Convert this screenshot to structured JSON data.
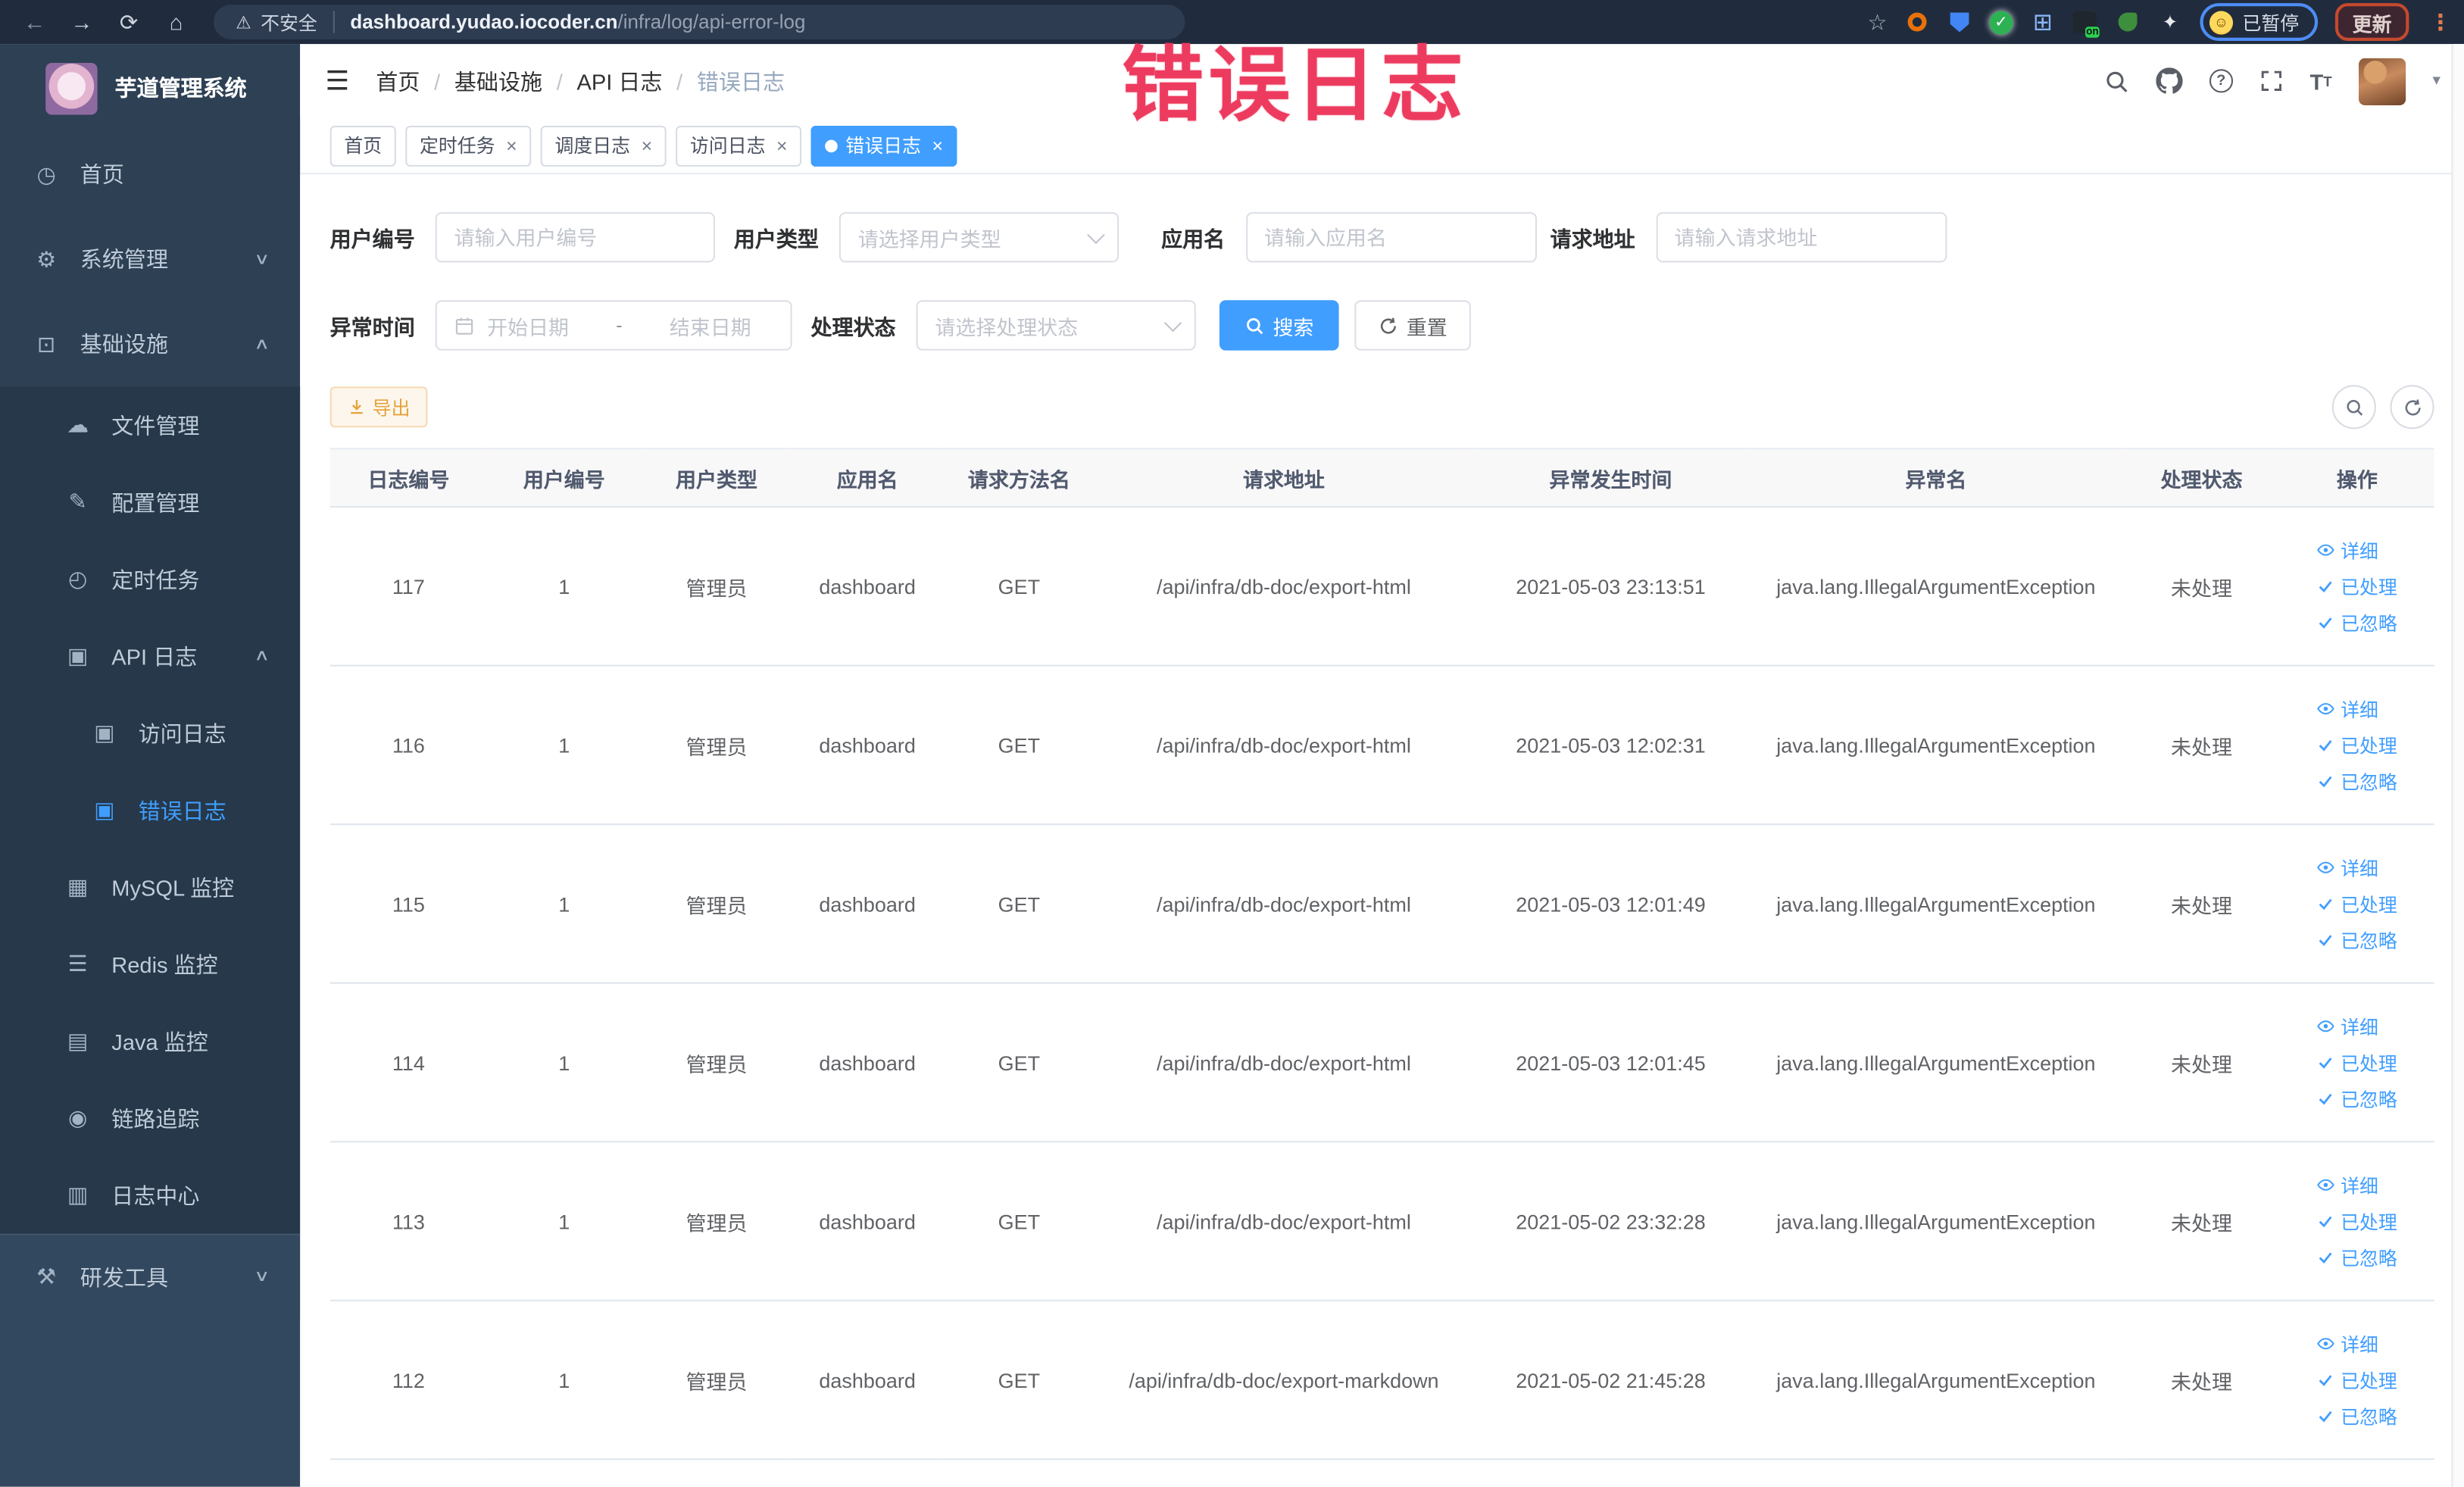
{
  "browser": {
    "security_label": "不安全",
    "url_host": "dashboard.yudao.iocoder.cn",
    "url_path": "/infra/log/api-error-log",
    "extension_badge": "on",
    "paused_badge": "已暂停",
    "update_label": "更新"
  },
  "annotation": "错误日志",
  "sidebar": {
    "title": "芋道管理系统",
    "items": [
      {
        "label": "首页",
        "icon": "dashboard-icon",
        "level": 1
      },
      {
        "label": "系统管理",
        "icon": "gear-icon",
        "level": 1,
        "arrow": "down"
      },
      {
        "label": "基础设施",
        "icon": "infrastructure-icon",
        "level": 1,
        "arrow": "up"
      },
      {
        "label": "文件管理",
        "icon": "file-manage-icon",
        "level": 2
      },
      {
        "label": "配置管理",
        "icon": "config-manage-icon",
        "level": 2
      },
      {
        "label": "定时任务",
        "icon": "scheduled-task-icon",
        "level": 2
      },
      {
        "label": "API 日志",
        "icon": "api-log-icon",
        "level": 2,
        "arrow": "up"
      },
      {
        "label": "访问日志",
        "icon": "access-log-icon",
        "level": 3
      },
      {
        "label": "错误日志",
        "icon": "error-log-icon",
        "level": 3,
        "active": true
      },
      {
        "label": "MySQL 监控",
        "icon": "mysql-monitor-icon",
        "level": 2
      },
      {
        "label": "Redis 监控",
        "icon": "redis-monitor-icon",
        "level": 2
      },
      {
        "label": "Java 监控",
        "icon": "java-monitor-icon",
        "level": 2
      },
      {
        "label": "链路追踪",
        "icon": "trace-icon",
        "level": 2
      },
      {
        "label": "日志中心",
        "icon": "log-center-icon",
        "level": 2
      },
      {
        "label": "研发工具",
        "icon": "devtools-icon",
        "level": 1,
        "arrow": "down",
        "section": "lower"
      }
    ]
  },
  "header": {
    "breadcrumbs": [
      "首页",
      "基础设施",
      "API 日志",
      "错误日志"
    ],
    "icons": [
      "search-icon",
      "github-icon",
      "help-icon",
      "fullscreen-icon",
      "font-size-icon",
      "avatar",
      "caret-down-icon"
    ]
  },
  "tabs": [
    {
      "label": "首页",
      "closable": false,
      "active": false
    },
    {
      "label": "定时任务",
      "closable": true,
      "active": false
    },
    {
      "label": "调度日志",
      "closable": true,
      "active": false
    },
    {
      "label": "访问日志",
      "closable": true,
      "active": false
    },
    {
      "label": "错误日志",
      "closable": true,
      "active": true
    }
  ],
  "filters": {
    "user_id": {
      "label": "用户编号",
      "placeholder": "请输入用户编号"
    },
    "user_type": {
      "label": "用户类型",
      "placeholder": "请选择用户类型"
    },
    "app_name": {
      "label": "应用名",
      "placeholder": "请输入应用名"
    },
    "request_url": {
      "label": "请求地址",
      "placeholder": "请输入请求地址"
    },
    "exception_time": {
      "label": "异常时间",
      "start_placeholder": "开始日期",
      "separator": "-",
      "end_placeholder": "结束日期"
    },
    "process_status": {
      "label": "处理状态",
      "placeholder": "请选择处理状态"
    },
    "search_label": "搜索",
    "reset_label": "重置"
  },
  "toolbar": {
    "export_label": "导出"
  },
  "table": {
    "columns": [
      "日志编号",
      "用户编号",
      "用户类型",
      "应用名",
      "请求方法名",
      "请求地址",
      "异常发生时间",
      "异常名",
      "处理状态",
      "操作"
    ],
    "actions": [
      "详细",
      "已处理",
      "已忽略"
    ],
    "rows": [
      {
        "id": "117",
        "user_id": "1",
        "user_type": "管理员",
        "app": "dashboard",
        "method": "GET",
        "url": "/api/infra/db-doc/export-html",
        "time": "2021-05-03 23:13:51",
        "exception": "java.lang.IllegalArgumentException",
        "status": "未处理"
      },
      {
        "id": "116",
        "user_id": "1",
        "user_type": "管理员",
        "app": "dashboard",
        "method": "GET",
        "url": "/api/infra/db-doc/export-html",
        "time": "2021-05-03 12:02:31",
        "exception": "java.lang.IllegalArgumentException",
        "status": "未处理"
      },
      {
        "id": "115",
        "user_id": "1",
        "user_type": "管理员",
        "app": "dashboard",
        "method": "GET",
        "url": "/api/infra/db-doc/export-html",
        "time": "2021-05-03 12:01:49",
        "exception": "java.lang.IllegalArgumentException",
        "status": "未处理"
      },
      {
        "id": "114",
        "user_id": "1",
        "user_type": "管理员",
        "app": "dashboard",
        "method": "GET",
        "url": "/api/infra/db-doc/export-html",
        "time": "2021-05-03 12:01:45",
        "exception": "java.lang.IllegalArgumentException",
        "status": "未处理"
      },
      {
        "id": "113",
        "user_id": "1",
        "user_type": "管理员",
        "app": "dashboard",
        "method": "GET",
        "url": "/api/infra/db-doc/export-html",
        "time": "2021-05-02 23:32:28",
        "exception": "java.lang.IllegalArgumentException",
        "status": "未处理"
      },
      {
        "id": "112",
        "user_id": "1",
        "user_type": "管理员",
        "app": "dashboard",
        "method": "GET",
        "url": "/api/infra/db-doc/export-markdown",
        "time": "2021-05-02 21:45:28",
        "exception": "java.lang.IllegalArgumentException",
        "status": "未处理"
      }
    ]
  },
  "colors": {
    "primary": "#409eff",
    "warning": "#e6a23c",
    "annotation_red": "#ed3b5f",
    "sidebar_bg": "#2d4054",
    "active_tab": "#409eff"
  }
}
